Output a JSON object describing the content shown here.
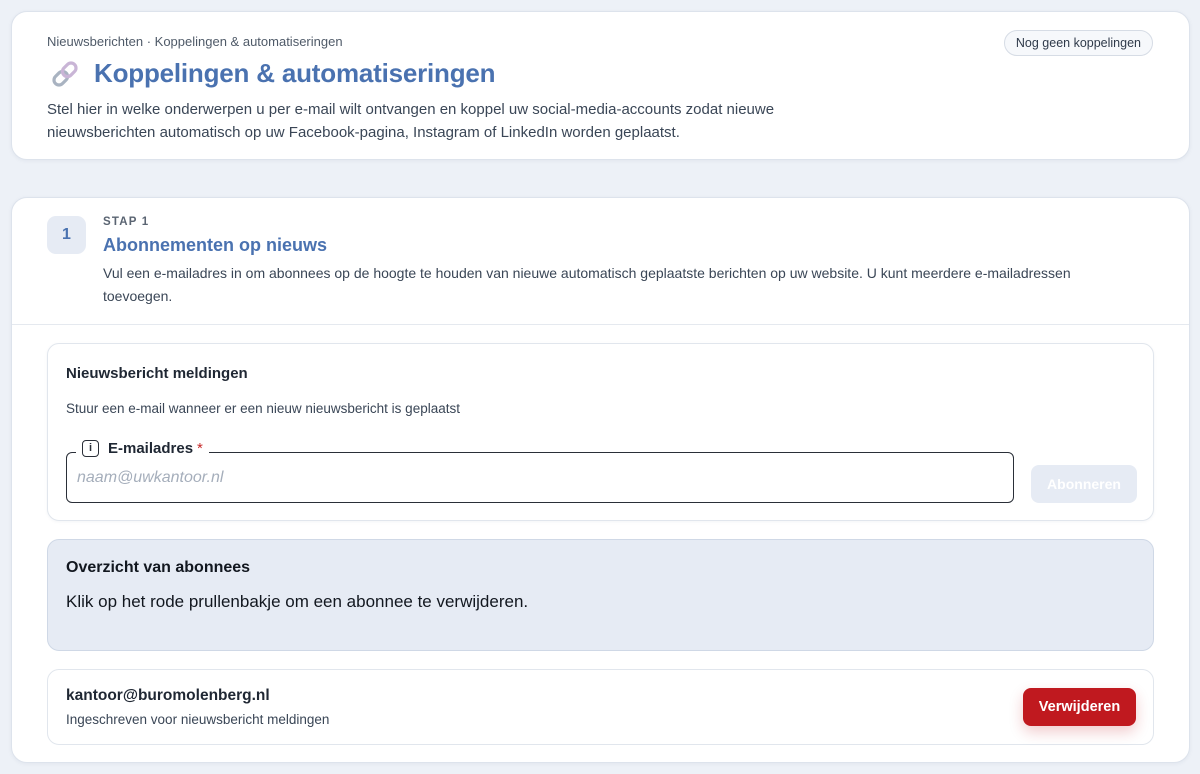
{
  "header": {
    "breadcrumb": "Nieuwsberichten · Koppelingen & automatiseringen",
    "title": "Koppelingen & automatiseringen",
    "title_icon": "link-icon",
    "description": "Stel hier in welke onderwerpen u per e-mail wilt ontvangen en koppel uw social-media-accounts zodat nieuwe nieuwsberichten automatisch op uw Facebook-pagina, Instagram of LinkedIn worden geplaatst.",
    "status_badge": "Nog geen koppelingen"
  },
  "step": {
    "number": "1",
    "label": "STAP 1",
    "title": "Abonnementen op nieuws",
    "description": "Vul een e-mailadres in om abonnees op de hoogte te houden van nieuwe automatisch geplaatste berichten op uw website. U kunt meerdere e-mailadressen toevoegen."
  },
  "notifications": {
    "title": "Nieuwsbericht meldingen",
    "description": "Stuur een e-mail wanneer er een nieuw nieuwsbericht is geplaatst",
    "email_label": "E-mailadres",
    "required_marker": "*",
    "email_value": "",
    "email_placeholder": "naam@uwkantoor.nl",
    "subscribe_label": "Abonneren",
    "info_icon": "info-icon"
  },
  "overview": {
    "title": "Overzicht van abonnees",
    "description": "Klik op het rode prullenbakje om een abonnee te verwijderen."
  },
  "subscribers": [
    {
      "email": "kantoor@buromolenberg.nl",
      "note": "Ingeschreven voor nieuwsbericht meldingen",
      "delete_label": "Verwijderen"
    }
  ],
  "colors": {
    "accent": "#4a72b0",
    "background": "#edf1f7",
    "danger": "#c0191f",
    "overview_background": "#e6ebf4"
  }
}
